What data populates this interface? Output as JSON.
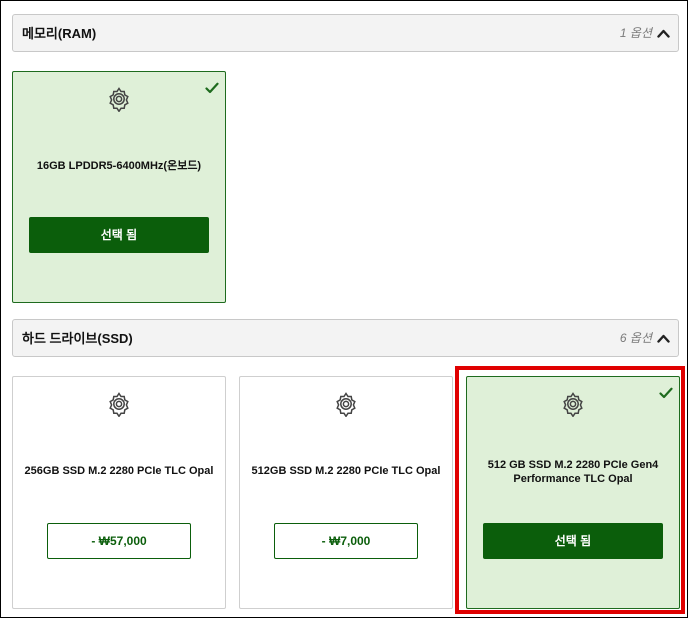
{
  "memory_section": {
    "title": "메모리(RAM)",
    "count": "1 옵션",
    "options": [
      {
        "name": "16GB LPDDR5-6400MHz(온보드)",
        "button": "선택 됨",
        "selected": true
      }
    ]
  },
  "storage_section": {
    "title": "하드 드라이브(SSD)",
    "count": "6 옵션",
    "options": [
      {
        "name": "256GB SSD M.2 2280 PCIe TLC Opal",
        "button": "- ₩57,000",
        "selected": false
      },
      {
        "name": "512GB SSD M.2 2280 PCIe TLC Opal",
        "button": "- ₩7,000",
        "selected": false
      },
      {
        "name": "512 GB SSD M.2 2280 PCIe Gen4 Performance TLC Opal",
        "button": "선택 됨",
        "selected": true
      }
    ]
  },
  "colors": {
    "accent": "#0b5e0b",
    "selected_bg": "#dff0d8",
    "highlight": "#e00000"
  },
  "icons": [
    "gear-icon",
    "checkmark-icon",
    "chevron-up-icon"
  ]
}
